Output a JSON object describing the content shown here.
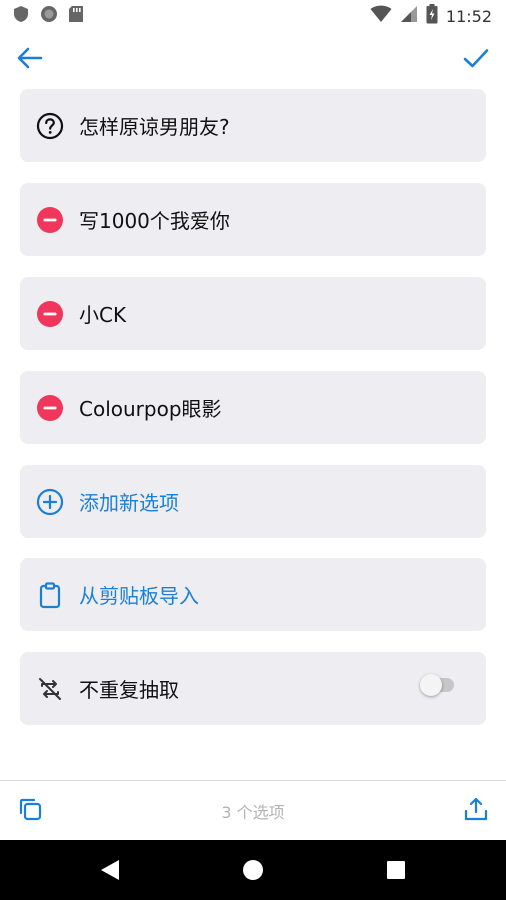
{
  "status_bar": {
    "time": "11:52",
    "icons": [
      "shield-icon",
      "circle-icon",
      "sd-card-icon",
      "wifi-icon",
      "signal-icon",
      "battery-charging-icon"
    ]
  },
  "app_bar": {
    "back_icon": "arrow-left-icon",
    "confirm_icon": "check-icon"
  },
  "question": {
    "icon": "help-circle-icon",
    "text": "怎样原谅男朋友?"
  },
  "options": [
    {
      "icon": "remove-circle-icon",
      "label": "写1000个我爱你"
    },
    {
      "icon": "remove-circle-icon",
      "label": "小CK"
    },
    {
      "icon": "remove-circle-icon",
      "label": "Colourpop眼影"
    }
  ],
  "actions": {
    "add_option": {
      "icon": "add-circle-icon",
      "label": "添加新选项"
    },
    "import_clipboard": {
      "icon": "clipboard-icon",
      "label": "从剪贴板导入"
    },
    "no_repeat": {
      "icon": "repeat-off-icon",
      "label": "不重复抽取",
      "enabled": false
    }
  },
  "bottom_bar": {
    "count_text": "3 个选项",
    "copy_icon": "copy-icon",
    "share_icon": "share-icon"
  },
  "colors": {
    "accent": "#1b7fd6",
    "remove": "#f0365a",
    "card_bg": "#eeeef2"
  }
}
